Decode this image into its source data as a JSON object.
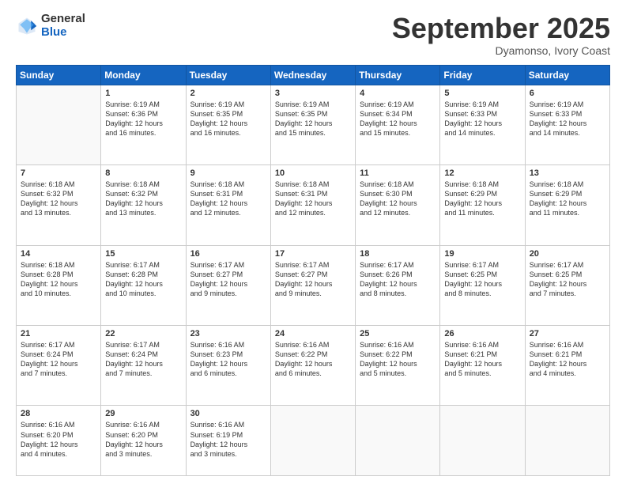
{
  "logo": {
    "general": "General",
    "blue": "Blue"
  },
  "header": {
    "title": "September 2025",
    "subtitle": "Dyamonso, Ivory Coast"
  },
  "days": [
    "Sunday",
    "Monday",
    "Tuesday",
    "Wednesday",
    "Thursday",
    "Friday",
    "Saturday"
  ],
  "weeks": [
    [
      {
        "num": "",
        "empty": true
      },
      {
        "num": "1",
        "sunrise": "Sunrise: 6:19 AM",
        "sunset": "Sunset: 6:36 PM",
        "daylight": "Daylight: 12 hours and 16 minutes."
      },
      {
        "num": "2",
        "sunrise": "Sunrise: 6:19 AM",
        "sunset": "Sunset: 6:35 PM",
        "daylight": "Daylight: 12 hours and 16 minutes."
      },
      {
        "num": "3",
        "sunrise": "Sunrise: 6:19 AM",
        "sunset": "Sunset: 6:35 PM",
        "daylight": "Daylight: 12 hours and 15 minutes."
      },
      {
        "num": "4",
        "sunrise": "Sunrise: 6:19 AM",
        "sunset": "Sunset: 6:34 PM",
        "daylight": "Daylight: 12 hours and 15 minutes."
      },
      {
        "num": "5",
        "sunrise": "Sunrise: 6:19 AM",
        "sunset": "Sunset: 6:33 PM",
        "daylight": "Daylight: 12 hours and 14 minutes."
      },
      {
        "num": "6",
        "sunrise": "Sunrise: 6:19 AM",
        "sunset": "Sunset: 6:33 PM",
        "daylight": "Daylight: 12 hours and 14 minutes."
      }
    ],
    [
      {
        "num": "7",
        "sunrise": "Sunrise: 6:18 AM",
        "sunset": "Sunset: 6:32 PM",
        "daylight": "Daylight: 12 hours and 13 minutes."
      },
      {
        "num": "8",
        "sunrise": "Sunrise: 6:18 AM",
        "sunset": "Sunset: 6:32 PM",
        "daylight": "Daylight: 12 hours and 13 minutes."
      },
      {
        "num": "9",
        "sunrise": "Sunrise: 6:18 AM",
        "sunset": "Sunset: 6:31 PM",
        "daylight": "Daylight: 12 hours and 12 minutes."
      },
      {
        "num": "10",
        "sunrise": "Sunrise: 6:18 AM",
        "sunset": "Sunset: 6:31 PM",
        "daylight": "Daylight: 12 hours and 12 minutes."
      },
      {
        "num": "11",
        "sunrise": "Sunrise: 6:18 AM",
        "sunset": "Sunset: 6:30 PM",
        "daylight": "Daylight: 12 hours and 12 minutes."
      },
      {
        "num": "12",
        "sunrise": "Sunrise: 6:18 AM",
        "sunset": "Sunset: 6:29 PM",
        "daylight": "Daylight: 12 hours and 11 minutes."
      },
      {
        "num": "13",
        "sunrise": "Sunrise: 6:18 AM",
        "sunset": "Sunset: 6:29 PM",
        "daylight": "Daylight: 12 hours and 11 minutes."
      }
    ],
    [
      {
        "num": "14",
        "sunrise": "Sunrise: 6:18 AM",
        "sunset": "Sunset: 6:28 PM",
        "daylight": "Daylight: 12 hours and 10 minutes."
      },
      {
        "num": "15",
        "sunrise": "Sunrise: 6:17 AM",
        "sunset": "Sunset: 6:28 PM",
        "daylight": "Daylight: 12 hours and 10 minutes."
      },
      {
        "num": "16",
        "sunrise": "Sunrise: 6:17 AM",
        "sunset": "Sunset: 6:27 PM",
        "daylight": "Daylight: 12 hours and 9 minutes."
      },
      {
        "num": "17",
        "sunrise": "Sunrise: 6:17 AM",
        "sunset": "Sunset: 6:27 PM",
        "daylight": "Daylight: 12 hours and 9 minutes."
      },
      {
        "num": "18",
        "sunrise": "Sunrise: 6:17 AM",
        "sunset": "Sunset: 6:26 PM",
        "daylight": "Daylight: 12 hours and 8 minutes."
      },
      {
        "num": "19",
        "sunrise": "Sunrise: 6:17 AM",
        "sunset": "Sunset: 6:25 PM",
        "daylight": "Daylight: 12 hours and 8 minutes."
      },
      {
        "num": "20",
        "sunrise": "Sunrise: 6:17 AM",
        "sunset": "Sunset: 6:25 PM",
        "daylight": "Daylight: 12 hours and 7 minutes."
      }
    ],
    [
      {
        "num": "21",
        "sunrise": "Sunrise: 6:17 AM",
        "sunset": "Sunset: 6:24 PM",
        "daylight": "Daylight: 12 hours and 7 minutes."
      },
      {
        "num": "22",
        "sunrise": "Sunrise: 6:17 AM",
        "sunset": "Sunset: 6:24 PM",
        "daylight": "Daylight: 12 hours and 7 minutes."
      },
      {
        "num": "23",
        "sunrise": "Sunrise: 6:16 AM",
        "sunset": "Sunset: 6:23 PM",
        "daylight": "Daylight: 12 hours and 6 minutes."
      },
      {
        "num": "24",
        "sunrise": "Sunrise: 6:16 AM",
        "sunset": "Sunset: 6:22 PM",
        "daylight": "Daylight: 12 hours and 6 minutes."
      },
      {
        "num": "25",
        "sunrise": "Sunrise: 6:16 AM",
        "sunset": "Sunset: 6:22 PM",
        "daylight": "Daylight: 12 hours and 5 minutes."
      },
      {
        "num": "26",
        "sunrise": "Sunrise: 6:16 AM",
        "sunset": "Sunset: 6:21 PM",
        "daylight": "Daylight: 12 hours and 5 minutes."
      },
      {
        "num": "27",
        "sunrise": "Sunrise: 6:16 AM",
        "sunset": "Sunset: 6:21 PM",
        "daylight": "Daylight: 12 hours and 4 minutes."
      }
    ],
    [
      {
        "num": "28",
        "sunrise": "Sunrise: 6:16 AM",
        "sunset": "Sunset: 6:20 PM",
        "daylight": "Daylight: 12 hours and 4 minutes."
      },
      {
        "num": "29",
        "sunrise": "Sunrise: 6:16 AM",
        "sunset": "Sunset: 6:20 PM",
        "daylight": "Daylight: 12 hours and 3 minutes."
      },
      {
        "num": "30",
        "sunrise": "Sunrise: 6:16 AM",
        "sunset": "Sunset: 6:19 PM",
        "daylight": "Daylight: 12 hours and 3 minutes."
      },
      {
        "num": "",
        "empty": true
      },
      {
        "num": "",
        "empty": true
      },
      {
        "num": "",
        "empty": true
      },
      {
        "num": "",
        "empty": true
      }
    ]
  ]
}
